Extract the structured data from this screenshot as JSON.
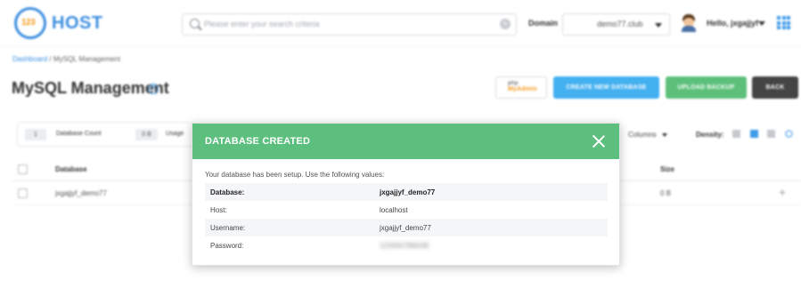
{
  "header": {
    "logo_badge": "123",
    "logo_text": "HOST",
    "search_placeholder": "Please enter your search criteria",
    "search_clear": "×",
    "domain_label": "Domain",
    "domain_value": "demo77.club",
    "greeting": "Hello, jxgajjyf"
  },
  "breadcrumb": {
    "link": "Dashboard",
    "separator": " / ",
    "current": "MySQL Management"
  },
  "page": {
    "title": "MySQL Management",
    "help": "?",
    "buttons": {
      "php_line1": "php",
      "php_line2": "MyAdmin",
      "create": "CREATE NEW DATABASE",
      "upload": "UPLOAD BACKUP",
      "back": "BACK"
    }
  },
  "stats": {
    "db_count_value": "1",
    "db_count_label": "Database Count",
    "usage_value": "0 B",
    "usage_label": "Usage"
  },
  "toolbar": {
    "columns": "Columns",
    "density": "Density:"
  },
  "table": {
    "headers": {
      "database": "Database",
      "size": "Size"
    },
    "rows": [
      {
        "database": "jxgajjyf_demo77",
        "size": "0 B"
      }
    ]
  },
  "modal": {
    "title": "DATABASE CREATED",
    "intro": "Your database has been setup. Use the following values:",
    "fields": [
      {
        "key": "Database:",
        "value": "jxgajjyf_demo77"
      },
      {
        "key": "Host:",
        "value": "localhost"
      },
      {
        "key": "Username:",
        "value": "jxgajjyf_demo77"
      },
      {
        "key": "Password:",
        "value": "1234567890AB"
      }
    ]
  },
  "colors": {
    "brand_blue": "#3d8fe0",
    "create_button": "#43b0f0",
    "upload_button": "#5cc07a",
    "back_button": "#444444",
    "modal_header": "#5dbf7d"
  }
}
